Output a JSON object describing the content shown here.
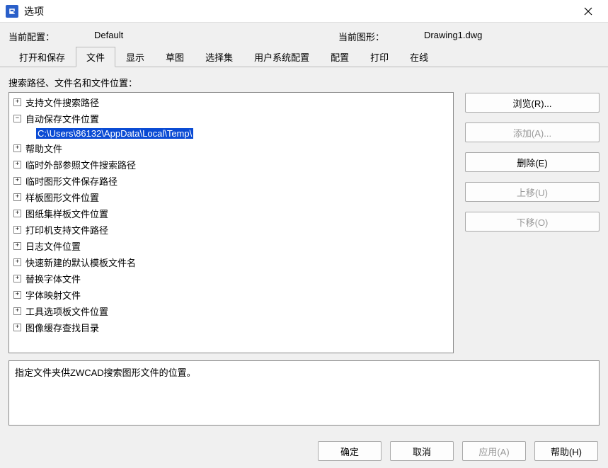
{
  "titlebar": {
    "title": "选项"
  },
  "info": {
    "config_label": "当前配置：",
    "config_value": "Default",
    "drawing_label": "当前图形：",
    "drawing_value": "Drawing1.dwg"
  },
  "tabs": [
    {
      "label": "打开和保存",
      "active": false
    },
    {
      "label": "文件",
      "active": true
    },
    {
      "label": "显示",
      "active": false
    },
    {
      "label": "草图",
      "active": false
    },
    {
      "label": "选择集",
      "active": false
    },
    {
      "label": "用户系统配置",
      "active": false
    },
    {
      "label": "配置",
      "active": false
    },
    {
      "label": "打印",
      "active": false
    },
    {
      "label": "在线",
      "active": false
    }
  ],
  "section_label": "搜索路径、文件名和文件位置：",
  "tree": [
    {
      "label": "支持文件搜索路径",
      "expanded": false,
      "children": []
    },
    {
      "label": "自动保存文件位置",
      "expanded": true,
      "children": [
        {
          "label": "C:\\Users\\86132\\AppData\\Local\\Temp\\",
          "selected": true
        }
      ]
    },
    {
      "label": "帮助文件",
      "expanded": false,
      "children": []
    },
    {
      "label": "临时外部参照文件搜索路径",
      "expanded": false,
      "children": []
    },
    {
      "label": "临时图形文件保存路径",
      "expanded": false,
      "children": []
    },
    {
      "label": "样板图形文件位置",
      "expanded": false,
      "children": []
    },
    {
      "label": "图纸集样板文件位置",
      "expanded": false,
      "children": []
    },
    {
      "label": "打印机支持文件路径",
      "expanded": false,
      "children": []
    },
    {
      "label": "日志文件位置",
      "expanded": false,
      "children": []
    },
    {
      "label": "快速新建的默认模板文件名",
      "expanded": false,
      "children": []
    },
    {
      "label": "替换字体文件",
      "expanded": false,
      "children": []
    },
    {
      "label": "字体映射文件",
      "expanded": false,
      "children": []
    },
    {
      "label": "工具选项板文件位置",
      "expanded": false,
      "children": []
    },
    {
      "label": "图像缓存查找目录",
      "expanded": false,
      "children": []
    }
  ],
  "buttons": {
    "browse": "浏览(R)...",
    "add": "添加(A)...",
    "delete": "删除(E)",
    "moveup": "上移(U)",
    "movedown": "下移(O)"
  },
  "desc": "指定文件夹供ZWCAD搜索图形文件的位置。",
  "footer": {
    "ok": "确定",
    "cancel": "取消",
    "apply": "应用(A)",
    "help": "帮助(H)"
  }
}
